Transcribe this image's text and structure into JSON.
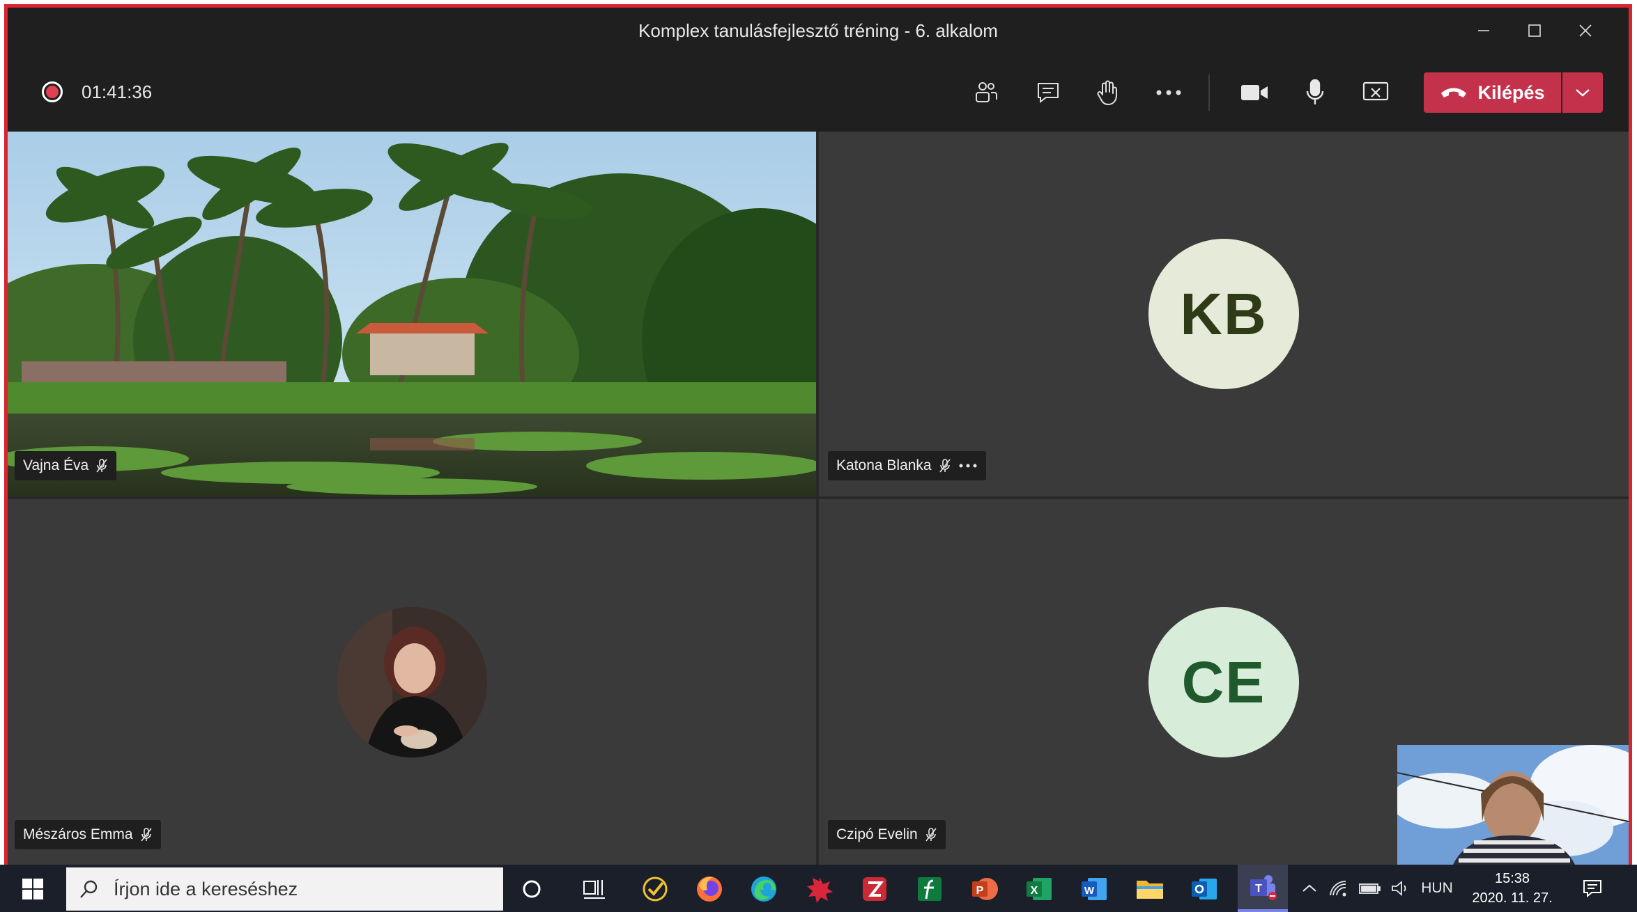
{
  "window": {
    "title": "Komplex tanulásfejlesztő tréning - 6. alkalom"
  },
  "toolbar": {
    "timer": "01:41:36",
    "leave_label": "Kilépés",
    "icons": [
      "participants-icon",
      "chat-icon",
      "raise-hand-icon",
      "more-icon",
      "camera-icon",
      "microphone-icon",
      "stop-share-icon",
      "hang-up-icon",
      "chevron-down-icon"
    ]
  },
  "participants": [
    {
      "name": "Vajna Éva",
      "initials": "",
      "muted": true,
      "has_video": true
    },
    {
      "name": "Katona Blanka",
      "initials": "KB",
      "muted": true,
      "has_video": false,
      "avatar_color": "#e6ead8",
      "initials_color": "#2f3a17"
    },
    {
      "name": "Mészáros Emma",
      "initials": "",
      "muted": true,
      "has_video": false,
      "has_photo": true
    },
    {
      "name": "Czipó Evelin",
      "initials": "CE",
      "muted": true,
      "has_video": false,
      "avatar_color": "#d7ecd9",
      "initials_color": "#1f5a2c"
    }
  ],
  "taskbar": {
    "search_placeholder": "Írjon ide a kereséshez",
    "language": "HUN",
    "time": "15:38",
    "date": "2020. 11. 27."
  },
  "colors": {
    "accent_leave": "#c4314b",
    "frame_border": "#d9252f",
    "stage_bg": "#292929",
    "tile_bg": "#3a3a3a"
  }
}
